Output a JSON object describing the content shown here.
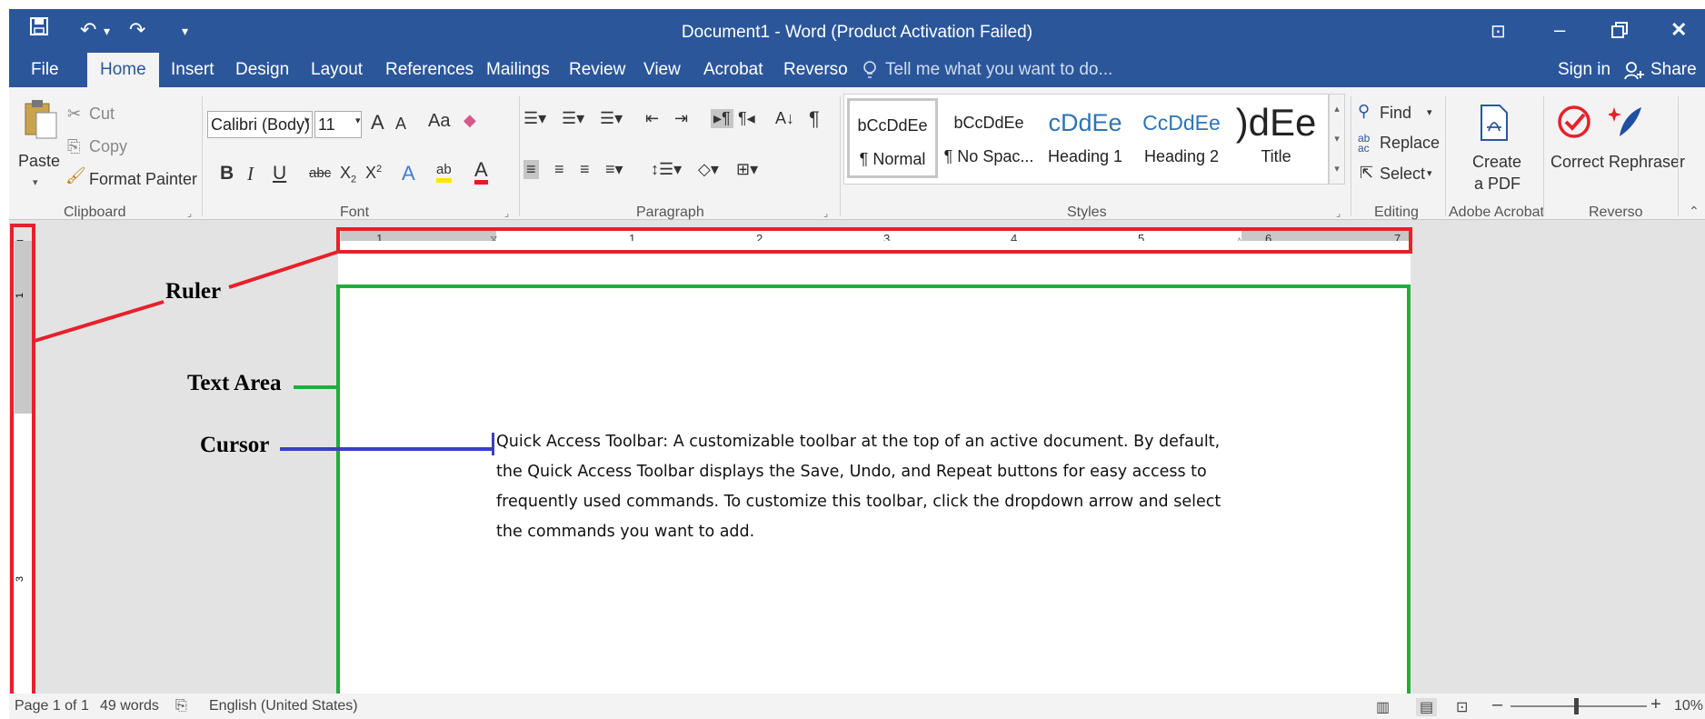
{
  "window": {
    "title": "Document1 - Word (Product Activation Failed)"
  },
  "qat": {
    "save_icon": "💾",
    "undo_icon": "↶",
    "undo_arrow": "▾",
    "redo_icon": "↷",
    "customize_icon": "▾"
  },
  "controls": {
    "ribbon_display": "⊡",
    "minimize": "–",
    "restore": "🗗",
    "close": "✕"
  },
  "tabs": {
    "file": "File",
    "home": "Home",
    "insert": "Insert",
    "design": "Design",
    "layout": "Layout",
    "references": "References",
    "mailings": "Mailings",
    "review": "Review",
    "view": "View",
    "acrobat": "Acrobat",
    "reverso": "Reverso",
    "tell_me": "Tell me what you want to do...",
    "sign_in": "Sign in",
    "share": "Share"
  },
  "clipboard": {
    "paste": "Paste",
    "cut": "Cut",
    "copy": "Copy",
    "format_painter": "Format Painter",
    "group": "Clipboard"
  },
  "font": {
    "family": "Calibri (Body)",
    "size": "11",
    "grow": "A",
    "shrink": "A",
    "change_case": "Aa",
    "bold": "B",
    "italic": "I",
    "underline": "U",
    "strike": "abc",
    "subscript": "X",
    "superscript": "X",
    "sub_mark": "2",
    "sup_mark": "2",
    "effects": "A",
    "highlight": "ab",
    "color": "A",
    "group": "Font"
  },
  "paragraph": {
    "group": "Paragraph",
    "sort": "A↓",
    "pilcrow": "¶"
  },
  "styles": {
    "group": "Styles",
    "items": [
      {
        "sample": "bCcDdEe",
        "name": "¶ Normal"
      },
      {
        "sample": "bCcDdEe",
        "name": "¶ No Spac..."
      },
      {
        "sample": "cDdEe",
        "name": "Heading 1"
      },
      {
        "sample": "CcDdEe",
        "name": "Heading 2"
      },
      {
        "sample": ")dEe",
        "name": "Title"
      }
    ]
  },
  "editing": {
    "find": "Find",
    "replace": "Replace",
    "select": "Select",
    "group": "Editing"
  },
  "acrobat": {
    "create_line1": "Create",
    "create_line2": "a PDF",
    "group": "Adobe Acrobat"
  },
  "reverso": {
    "correct": "Correct",
    "rephraser": "Rephraser",
    "group": "Reverso"
  },
  "ruler": {
    "h_numbers": [
      "1",
      "1",
      "2",
      "3",
      "4",
      "5",
      "6",
      "7"
    ],
    "v_numbers": [
      "1",
      "3"
    ]
  },
  "annotations": {
    "ruler": "Ruler",
    "text_area": "Text Area",
    "cursor": "Cursor"
  },
  "document": {
    "text": "Quick Access Toolbar: A customizable toolbar at the top of an active document. By default, the Quick Access Toolbar displays the Save, Undo, and Repeat buttons for easy access to frequently used commands. To customize this toolbar, click the dropdown arrow and select the commands you want to add."
  },
  "status": {
    "page": "Page 1 of 1",
    "words": "49 words",
    "language": "English (United States)",
    "zoom": "10%",
    "minus": "–",
    "plus": "+"
  },
  "colors": {
    "accent": "#2b579a",
    "annotation_red": "#e8202a",
    "annotation_green": "#1fae3c",
    "annotation_blue": "#3a3fbf"
  }
}
